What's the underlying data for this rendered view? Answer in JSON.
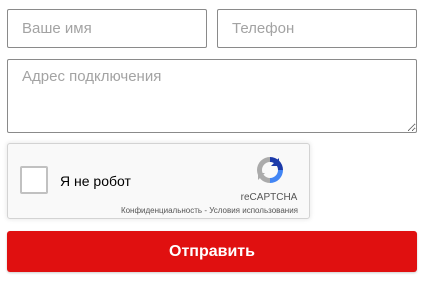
{
  "form": {
    "name_placeholder": "Ваше имя",
    "name_value": "",
    "phone_placeholder": "Телефон",
    "phone_value": "",
    "address_placeholder": "Адрес подключения",
    "address_value": "",
    "submit_label": "Отправить"
  },
  "recaptcha": {
    "checkbox_label": "Я не робот",
    "checked": false,
    "brand": "reCAPTCHA",
    "privacy_link": "Конфиденциальность",
    "separator": " - ",
    "terms_link": "Условия использования",
    "logo_icon": "recaptcha-logo-icon"
  },
  "colors": {
    "submit_background": "#e01010",
    "submit_text": "#ffffff",
    "field_border": "#8a8a8a",
    "recaptcha_background": "#f9f9f9"
  }
}
